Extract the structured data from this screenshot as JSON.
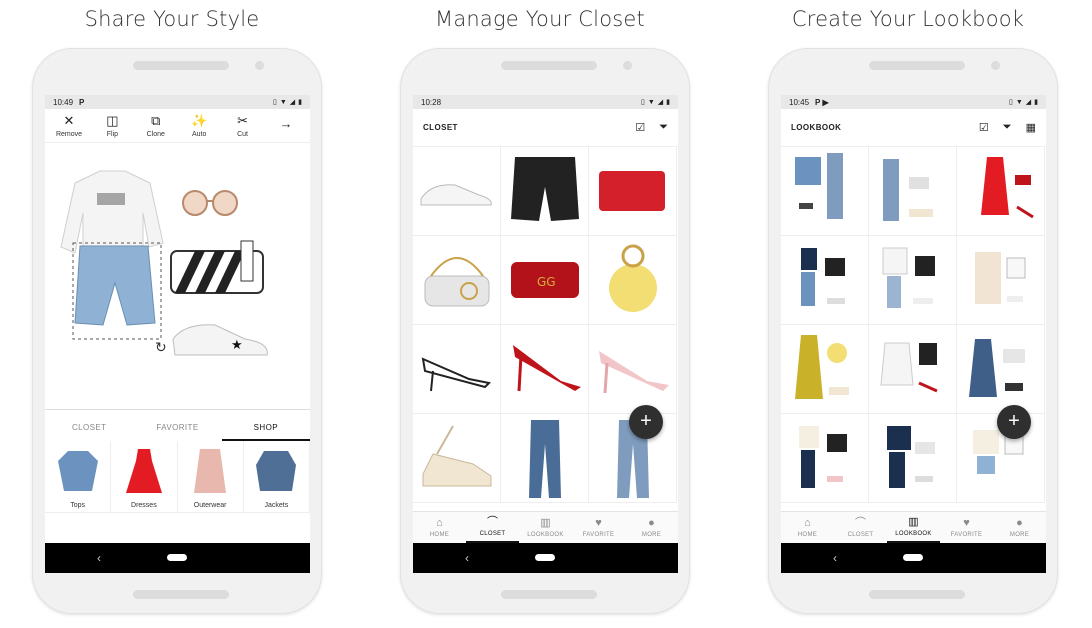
{
  "panels": [
    {
      "title": "Share Your Style",
      "time": "10:49",
      "status_icon": "P"
    },
    {
      "title": "Manage Your Closet",
      "time": "10:28"
    },
    {
      "title": "Create Your Lookbook",
      "time": "10:45",
      "status_icon": "P ▶"
    }
  ],
  "editor": {
    "tools": [
      {
        "icon": "close-icon",
        "label": "Remove"
      },
      {
        "icon": "flip-icon",
        "label": "Flip"
      },
      {
        "icon": "clone-icon",
        "label": "Clone"
      },
      {
        "icon": "magic-wand-icon",
        "label": "Auto"
      },
      {
        "icon": "scissors-icon",
        "label": "Cut"
      },
      {
        "icon": "arrow-right-icon",
        "label": ""
      }
    ],
    "tabs": [
      "CLOSET",
      "FAVORITE",
      "SHOP"
    ],
    "active_tab": "SHOP",
    "categories": [
      "Tops",
      "Dresses",
      "Outerwear",
      "Jackets"
    ]
  },
  "closet": {
    "title": "CLOSET",
    "actions": [
      "checkbox-icon",
      "filter-icon"
    ]
  },
  "lookbook": {
    "title": "LOOKBOOK",
    "actions": [
      "checkbox-icon",
      "filter-icon",
      "calendar-icon"
    ]
  },
  "bottom_nav": [
    "HOME",
    "CLOSET",
    "LOOKBOOK",
    "FAVORITE",
    "MORE"
  ],
  "fab_label": "+",
  "colors": {
    "accent": "#111111",
    "fab": "#2f2f2f",
    "bag_red": "#c8102e",
    "denim": "#5a7fa8"
  }
}
